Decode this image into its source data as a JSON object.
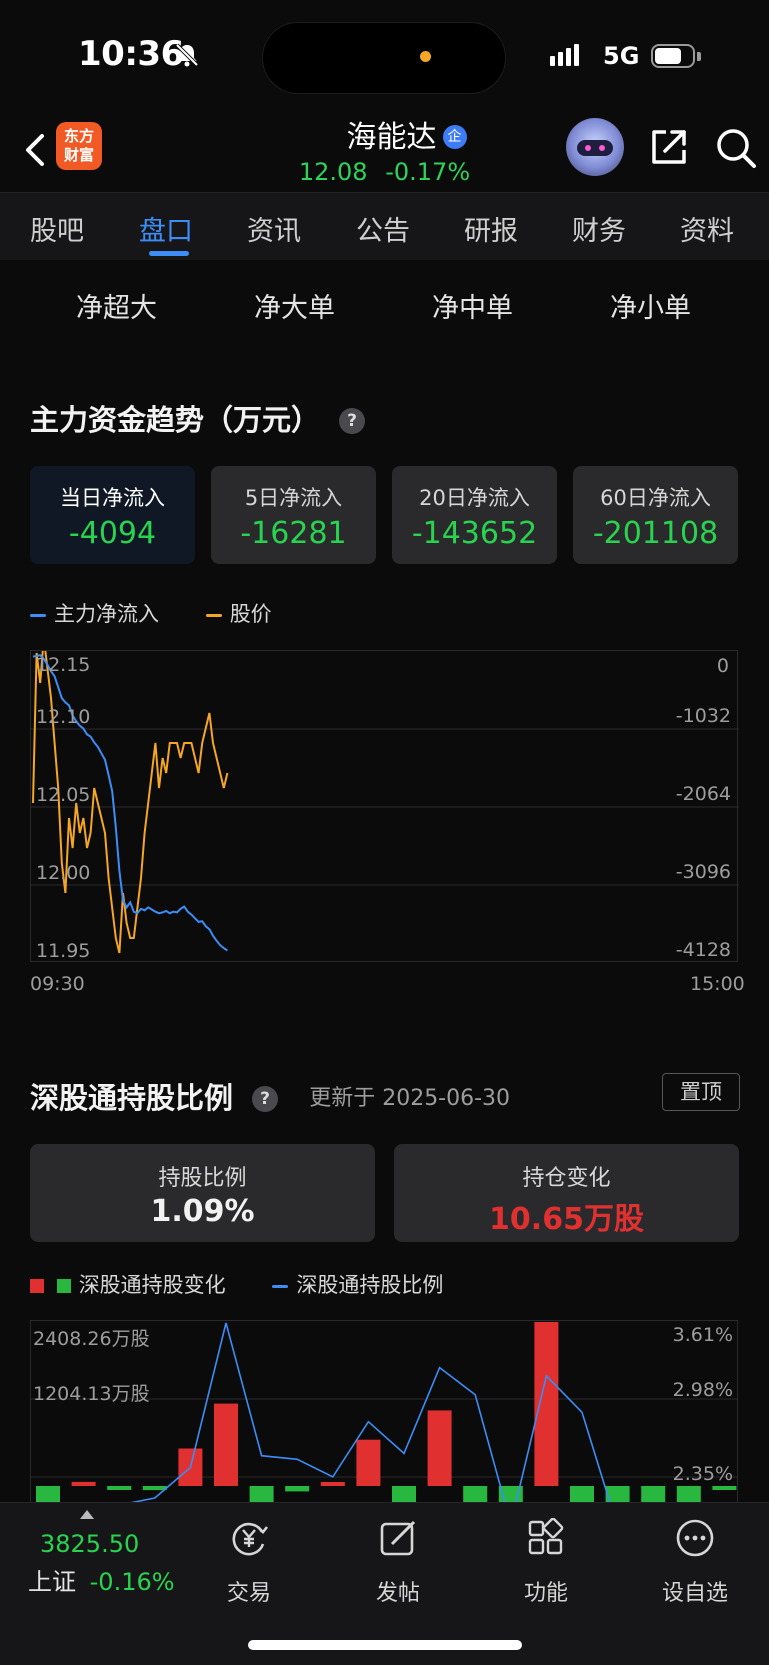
{
  "status_bar": {
    "time": "10:36",
    "network": "5G"
  },
  "header": {
    "logo_line1": "东方",
    "logo_line2": "财富",
    "stock_name": "海能达",
    "badge": "企",
    "price": "12.08",
    "change_pct": "-0.17%"
  },
  "tabs": [
    "股吧",
    "盘口",
    "资讯",
    "公告",
    "研报",
    "财务",
    "资料"
  ],
  "active_tab": "盘口",
  "flow_filters": [
    "净超大",
    "净大单",
    "净中单",
    "净小单"
  ],
  "fund_trend": {
    "title": "主力资金趋势（万元）",
    "cards": [
      {
        "label": "当日净流入",
        "value": "-4094"
      },
      {
        "label": "5日净流入",
        "value": "-16281"
      },
      {
        "label": "20日净流入",
        "value": "-143652"
      },
      {
        "label": "60日净流入",
        "value": "-201108"
      }
    ],
    "legend_main": "主力净流入",
    "legend_price": "股价"
  },
  "chart_data": [
    {
      "type": "line",
      "title": "",
      "y_left_ticks": [
        "12.15",
        "12.10",
        "12.05",
        "12.00",
        "11.95"
      ],
      "y_right_ticks": [
        "0",
        "-1032",
        "-2064",
        "-3096",
        "-4128"
      ],
      "x_ticks": [
        "09:30",
        "15:00"
      ],
      "ylim_price": [
        11.95,
        12.15
      ],
      "ylim_flow": [
        -4128,
        0
      ],
      "series": [
        {
          "name": "股价",
          "color": "#f5a623",
          "axis": "left",
          "values": [
            12.05,
            12.15,
            12.13,
            12.16,
            12.14,
            12.12,
            12.09,
            12.06,
            12.01,
            11.99,
            12.04,
            12.02,
            12.05,
            12.03,
            12.04,
            12.02,
            12.03,
            12.06,
            12.05,
            12.04,
            12.03,
            12.0,
            11.98,
            11.96,
            11.95,
            11.99,
            11.97,
            11.96,
            11.96,
            11.98,
            12.0,
            12.03,
            12.05,
            12.07,
            12.09,
            12.06,
            12.08,
            12.07,
            12.09,
            12.09,
            12.09,
            12.08,
            12.09,
            12.09,
            12.09,
            12.08,
            12.07,
            12.09,
            12.1,
            12.11,
            12.09,
            12.08,
            12.07,
            12.06,
            12.07
          ]
        },
        {
          "name": "主力净流入",
          "color": "#3c8df5",
          "axis": "right",
          "values": [
            -50,
            -40,
            -30,
            -80,
            -160,
            -250,
            -320,
            -470,
            -620,
            -680,
            -720,
            -860,
            -940,
            -1000,
            -1040,
            -1120,
            -1150,
            -1230,
            -1290,
            -1380,
            -1470,
            -1680,
            -1900,
            -2400,
            -3000,
            -3400,
            -3500,
            -3430,
            -3560,
            -3580,
            -3520,
            -3540,
            -3500,
            -3530,
            -3560,
            -3580,
            -3570,
            -3550,
            -3580,
            -3560,
            -3570,
            -3520,
            -3490,
            -3560,
            -3600,
            -3650,
            -3700,
            -3690,
            -3760,
            -3800,
            -3890,
            -3960,
            -4020,
            -4060,
            -4094
          ]
        }
      ]
    },
    {
      "type": "bar",
      "title": "",
      "y_left_ticks": [
        "2408.26万股",
        "1204.13万股"
      ],
      "y_right_ticks": [
        "3.61%",
        "2.98%",
        "2.35%"
      ],
      "series": [
        {
          "name": "深股通持股变化",
          "values": [
            -420,
            60,
            -40,
            -60,
            550,
            1210,
            -420,
            -80,
            30,
            680,
            -310,
            1110,
            -400,
            -400,
            2408,
            -300,
            -360,
            -360,
            -400,
            -8
          ]
        },
        {
          "name": "深股通持股比例",
          "values": [
            2.03,
            2.05,
            2.06,
            2.12,
            2.38,
            3.61,
            2.48,
            2.45,
            2.3,
            2.77,
            2.5,
            3.23,
            3.0,
            1.9,
            3.16,
            2.85,
            1.87,
            1.9,
            1.88,
            1.9
          ]
        }
      ]
    }
  ],
  "northbound": {
    "title": "深股通持股比例",
    "updated": "更新于 2025-06-30",
    "pin_label": "置顶",
    "hold_ratio_label": "持股比例",
    "hold_ratio_value": "1.09%",
    "hold_change_label": "持仓变化",
    "hold_change_value": "10.65万股",
    "legend_bars": "深股通持股变化",
    "legend_line": "深股通持股比例"
  },
  "bottom_nav": {
    "index_value": "3825.50",
    "index_name": "上证",
    "index_change": "-0.16%",
    "items": [
      "交易",
      "发帖",
      "功能",
      "设自选"
    ]
  },
  "colors": {
    "up": "#e03030",
    "down": "#28d44f",
    "accent": "#3c8df5",
    "price_line": "#f5a623"
  }
}
